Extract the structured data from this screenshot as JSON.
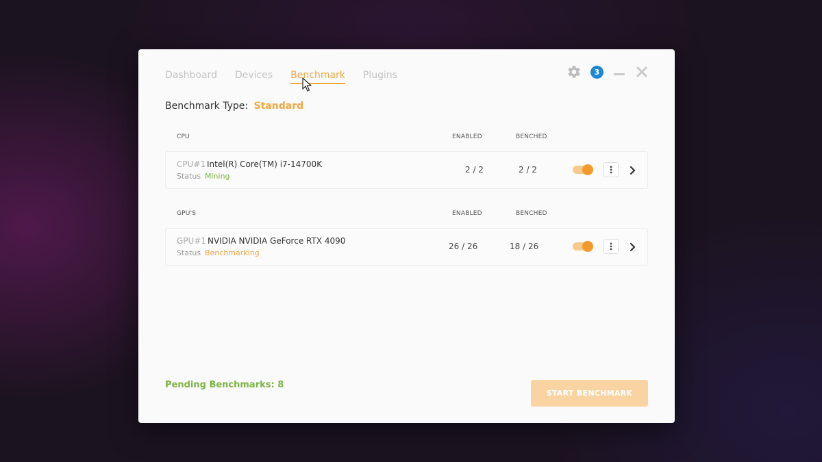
{
  "tabs": [
    {
      "label": "Dashboard"
    },
    {
      "label": "Devices"
    },
    {
      "label": "Benchmark"
    },
    {
      "label": "Plugins"
    }
  ],
  "active_tab": "Benchmark",
  "header": {
    "notification_count": "3",
    "icons": [
      "gear-icon",
      "notification-badge",
      "minimize-icon",
      "close-icon"
    ]
  },
  "benchmark_type": {
    "label": "Benchmark Type:",
    "value": "Standard"
  },
  "columns": {
    "enabled": "ENABLED",
    "benched": "BENCHED"
  },
  "sections": [
    {
      "title": "CPU",
      "devices": [
        {
          "id": "CPU#1",
          "name": "Intel(R) Core(TM) i7-14700K",
          "status_label": "Status",
          "status": "Mining",
          "enabled": "2 / 2",
          "benched": "2 / 2",
          "toggle_on": true
        }
      ]
    },
    {
      "title": "GPU'S",
      "devices": [
        {
          "id": "GPU#1",
          "name": "NVIDIA NVIDIA GeForce RTX 4090",
          "status_label": "Status",
          "status": "Benchmarking",
          "enabled": "26 / 26",
          "benched": "18 / 26",
          "toggle_on": true
        }
      ]
    }
  ],
  "footer": {
    "pending": "Pending Benchmarks: 8",
    "start_button": "START BENCHMARK"
  },
  "colors": {
    "accent": "#f0a742",
    "mining": "#7cb342",
    "benchmarking": "#f0a742",
    "badge": "#1b87d6",
    "button_disabled": "#f9d3a2"
  }
}
